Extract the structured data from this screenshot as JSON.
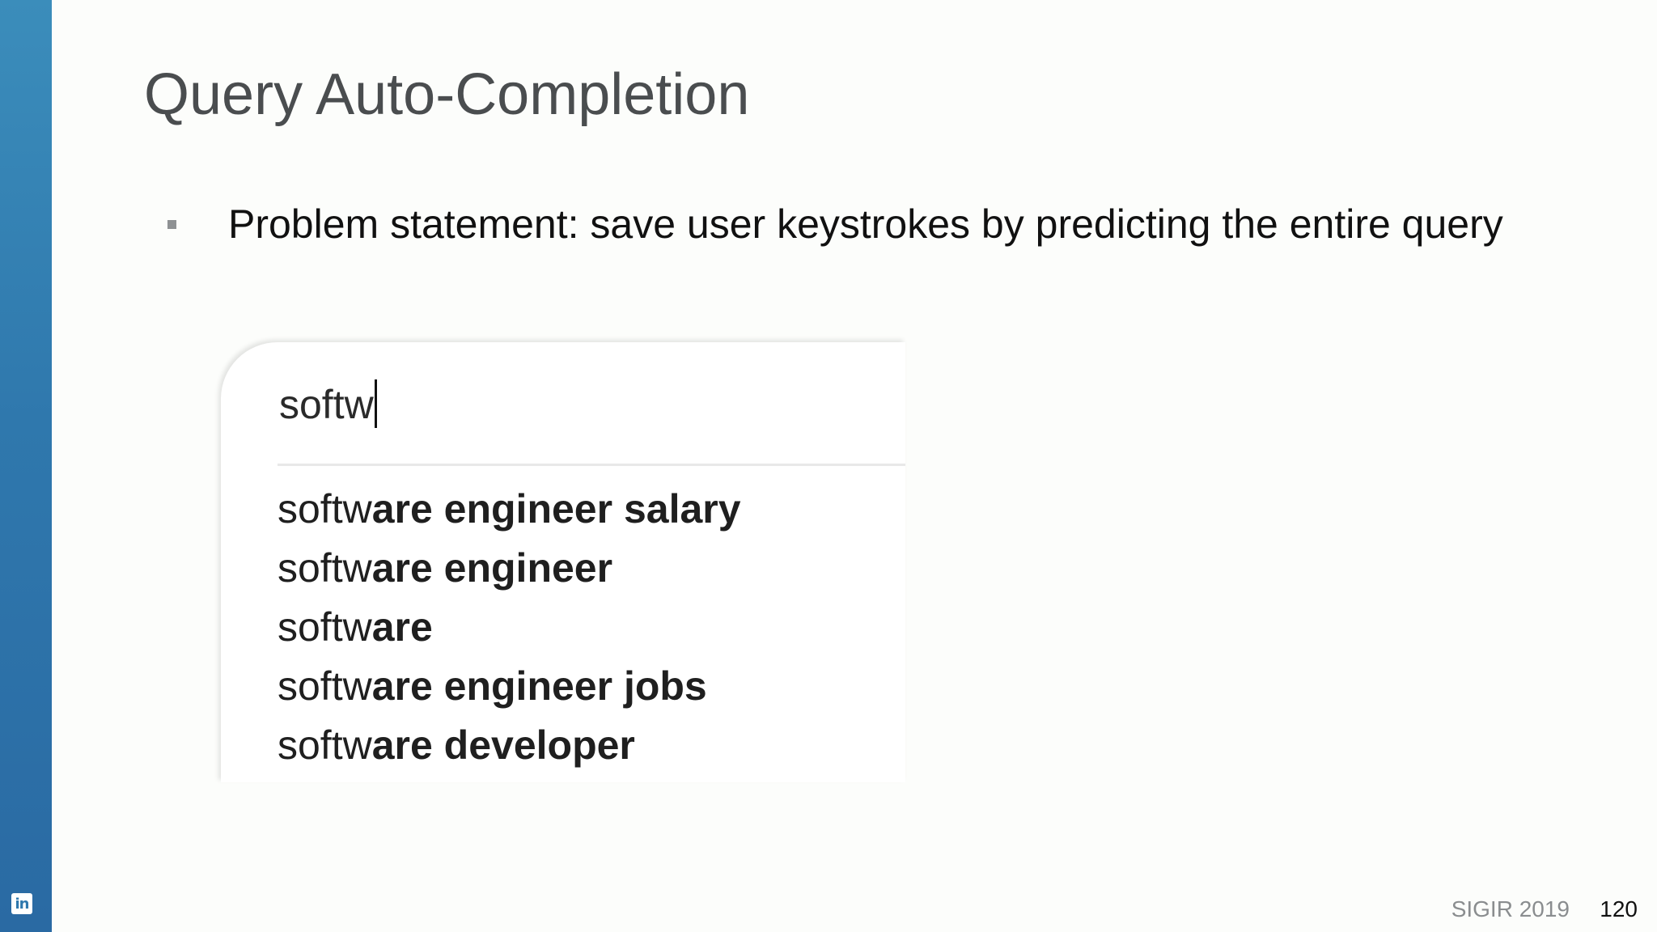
{
  "sidebar": {
    "brand_icon": "linkedin-icon",
    "logo_text": "in",
    "color": "#2f78ad"
  },
  "slide": {
    "title": "Query Auto-Completion",
    "bullet": "Problem statement: save user keystrokes by predicting the entire query"
  },
  "autocomplete": {
    "input_value": "softw",
    "suggestions": [
      {
        "typed": "softw",
        "completion": "are engineer salary"
      },
      {
        "typed": "softw",
        "completion": "are engineer"
      },
      {
        "typed": "softw",
        "completion": "are"
      },
      {
        "typed": "softw",
        "completion": "are engineer jobs"
      },
      {
        "typed": "softw",
        "completion": "are developer"
      }
    ]
  },
  "footer": {
    "conference": "SIGIR 2019",
    "page_number": "120"
  }
}
